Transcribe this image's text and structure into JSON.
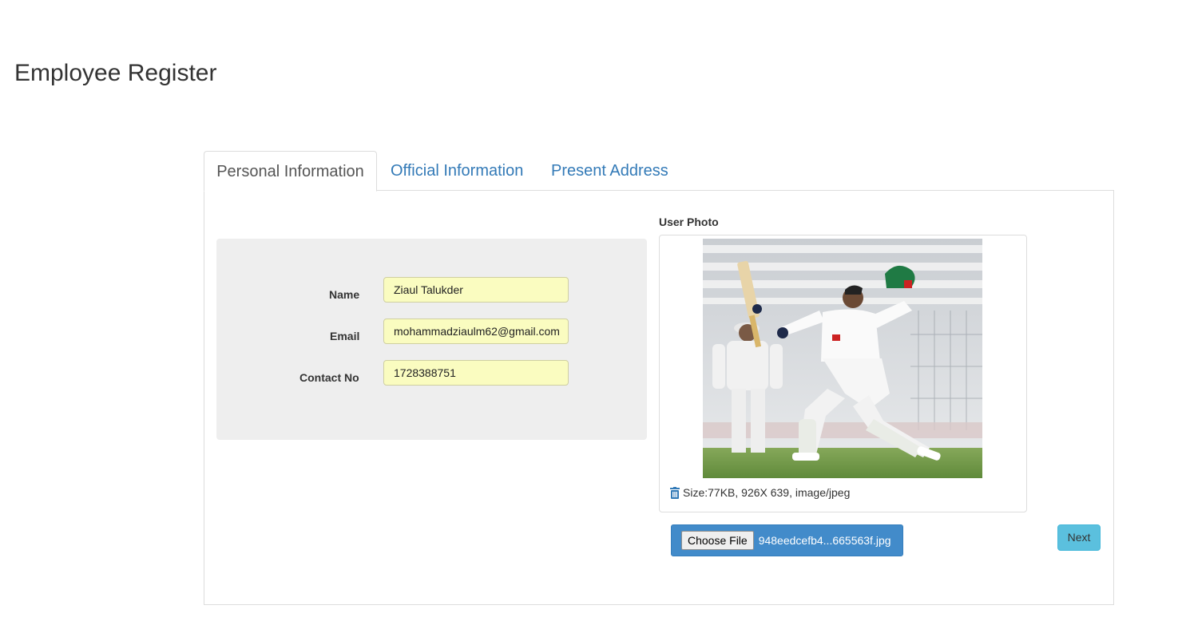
{
  "page": {
    "title": "Employee Register"
  },
  "tabs": [
    {
      "label": "Personal Information",
      "active": true
    },
    {
      "label": "Official Information",
      "active": false
    },
    {
      "label": "Present Address",
      "active": false
    }
  ],
  "form": {
    "name_label": "Name",
    "name_value": "Ziaul Talukder",
    "email_label": "Email",
    "email_value": "mohammadziaulm62@gmail.com",
    "contact_label": "Contact No",
    "contact_value": "1728388751"
  },
  "photo": {
    "label": "User Photo",
    "meta": "Size:77KB, 926X 639, image/jpeg",
    "trash_icon": "trash-icon"
  },
  "upload": {
    "choose_label": "Choose File",
    "file_name": "948eedcefb4...665563f.jpg"
  },
  "actions": {
    "next_label": "Next"
  },
  "colors": {
    "link": "#337ab7",
    "input_bg": "#fafcc0",
    "well_bg": "#eeeeee",
    "upload_bg": "#428bca",
    "next_bg": "#5bc0de"
  }
}
